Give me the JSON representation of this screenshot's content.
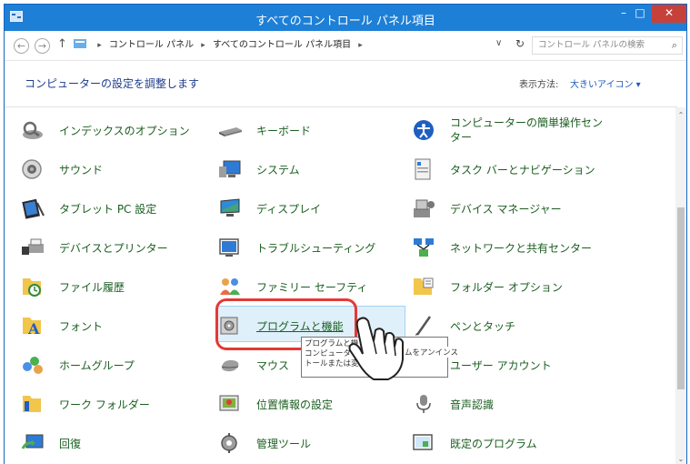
{
  "window": {
    "title": "すべてのコントロール パネル項目"
  },
  "titlebar": {
    "minimize": "–",
    "maximize": "□",
    "close": "✕"
  },
  "address": {
    "crumbs": [
      "コントロール パネル",
      "すべてのコントロール パネル項目"
    ],
    "sep": "▸",
    "dropdown": "∨",
    "refresh": "↻",
    "search_placeholder": "コントロール パネルの検索",
    "search_icon": "⌕"
  },
  "header": {
    "title": "コンピューターの設定を調整します",
    "view_label": "表示方法:",
    "view_value": "大きいアイコン ▾"
  },
  "items": [
    {
      "label": "インデックスのオプション"
    },
    {
      "label": "キーボード"
    },
    {
      "label": "コンピューターの簡単操作センター"
    },
    {
      "label": "サウンド"
    },
    {
      "label": "システム"
    },
    {
      "label": "タスク バーとナビゲーション"
    },
    {
      "label": "タブレット PC 設定"
    },
    {
      "label": "ディスプレイ"
    },
    {
      "label": "デバイス マネージャー"
    },
    {
      "label": "デバイスとプリンター"
    },
    {
      "label": "トラブルシューティング"
    },
    {
      "label": "ネットワークと共有センター"
    },
    {
      "label": "ファイル履歴"
    },
    {
      "label": "ファミリー セーフティ"
    },
    {
      "label": "フォルダー オプション"
    },
    {
      "label": "フォント"
    },
    {
      "label": "プログラムと機能"
    },
    {
      "label": "ペンとタッチ"
    },
    {
      "label": "ホームグループ"
    },
    {
      "label": "マウス"
    },
    {
      "label": "ユーザー アカウント"
    },
    {
      "label": "ワーク フォルダー"
    },
    {
      "label": "位置情報の設定"
    },
    {
      "label": "音声認識"
    },
    {
      "label": "回復"
    },
    {
      "label": "管理ツール"
    },
    {
      "label": "既定のプログラム"
    }
  ],
  "tooltip": {
    "lines": [
      "プログラムと機",
      "コンピュータ",
      "トールまたは変"
    ],
    "tail": "ムをアンインス"
  },
  "colors": {
    "titlebar": "#1e7fd6",
    "link_green": "#1b5e20",
    "highlight": "#e53935"
  }
}
